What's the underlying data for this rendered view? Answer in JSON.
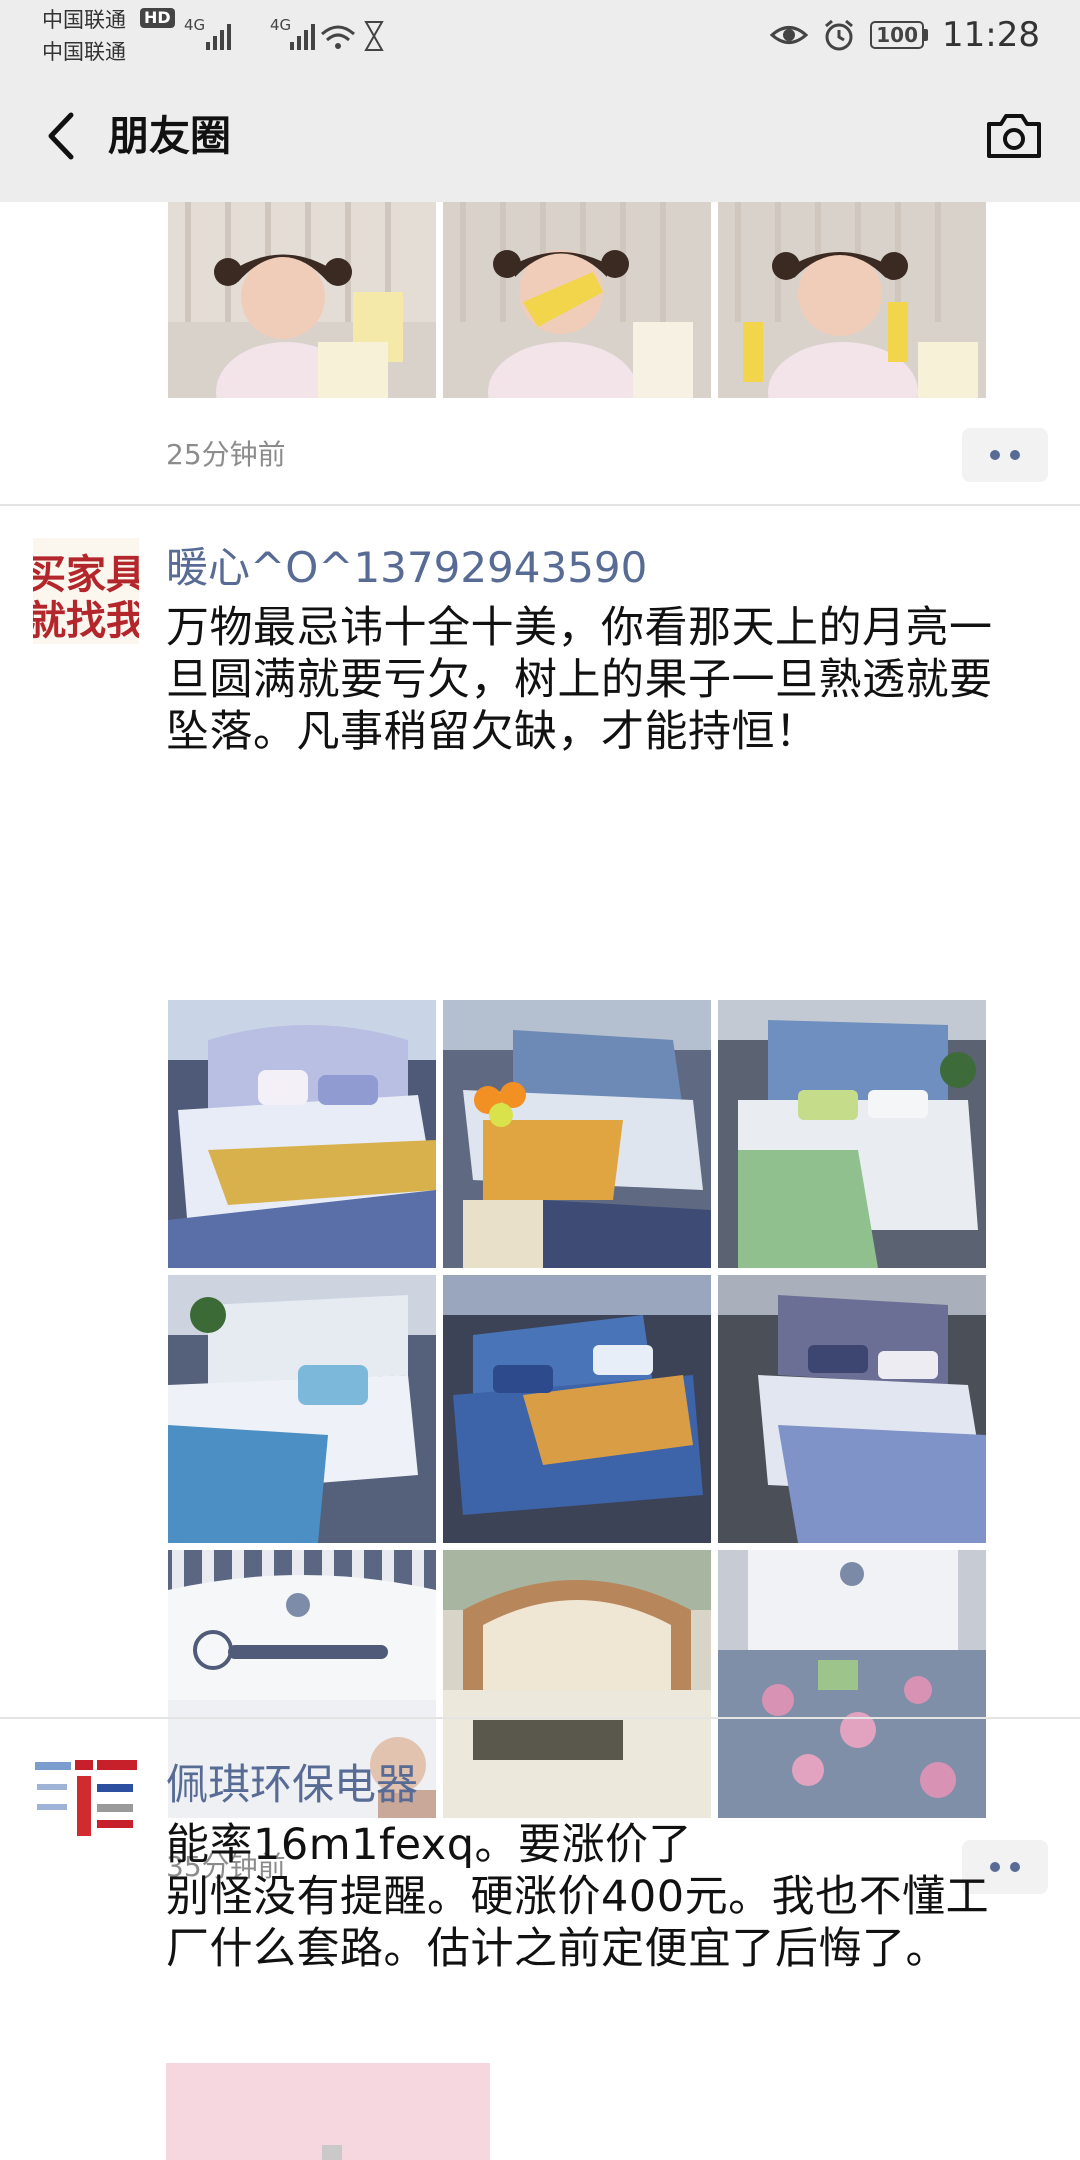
{
  "status_bar": {
    "carrier_1": "中国联通",
    "carrier_2": "中国联通",
    "hd_badge": "HD",
    "network_1": "4G",
    "network_2": "4G",
    "battery": "100",
    "time": "11:28"
  },
  "nav": {
    "title": "朋友圈",
    "back_icon": "chevron-left-icon",
    "camera_icon": "camera-icon"
  },
  "posts": [
    {
      "time_ago": "25分钟前",
      "photo_count_visible": 3
    },
    {
      "avatar_text": "买家具\n就找我",
      "nickname": "暖心^O^13792943590",
      "text": "万物最忌讳十全十美，你看那天上的月亮一旦圆满就要亏欠，树上的果子一旦熟透就要坠落。凡事稍留欠缺，才能持恒！",
      "photo_count": 9,
      "time_ago": "35分钟前"
    },
    {
      "nickname": "佩琪环保电器",
      "text": "能率16m1fexq。要涨价了\n别怪没有提醒。硬涨价400元。我也不懂工厂什么套路。估计之前定便宜了后悔了。"
    }
  ]
}
